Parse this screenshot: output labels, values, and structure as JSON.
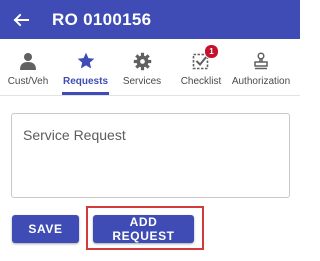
{
  "appbar": {
    "title": "RO 0100156",
    "back_icon": "arrow-left-icon",
    "background": "#3f4cb5"
  },
  "tabs": [
    {
      "label": "Cust/Veh",
      "icon": "person-icon",
      "active": false
    },
    {
      "label": "Requests",
      "icon": "star-icon",
      "active": true
    },
    {
      "label": "Services",
      "icon": "gear-icon",
      "active": false
    },
    {
      "label": "Checklist",
      "icon": "checkbox-icon",
      "active": false,
      "badge": "1"
    },
    {
      "label": "Authorization",
      "icon": "stamp-icon",
      "active": false
    }
  ],
  "form": {
    "service_request_placeholder": "Service Request",
    "service_request_value": ""
  },
  "buttons": {
    "save_label": "SAVE",
    "add_request_label": "ADD REQUEST"
  },
  "colors": {
    "primary": "#3f4cb5",
    "badge": "#c3122c",
    "highlight": "#d33a3a"
  }
}
